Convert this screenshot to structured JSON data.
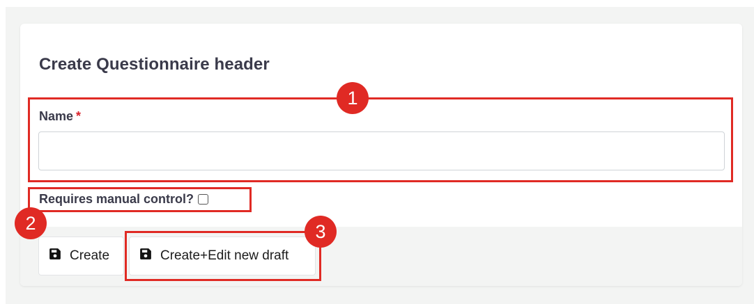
{
  "form": {
    "title": "Create Questionnaire header",
    "name_label": "Name",
    "required_mark": "*",
    "name_value": "",
    "name_placeholder": "",
    "manual_control_label": "Requires manual control?",
    "manual_control_checked": false
  },
  "actions": {
    "create_label": "Create",
    "create_draft_label": "Create+Edit new draft",
    "button_icon": "save-icon"
  },
  "annotations": [
    {
      "number": "1",
      "target": "name-field"
    },
    {
      "number": "2",
      "target": "manual-control-checkbox"
    },
    {
      "number": "3",
      "target": "create-edit-draft-button"
    }
  ],
  "colors": {
    "annotation_red": "#e02a24",
    "required_red": "#d9222a",
    "text_dark": "#3a3a4a",
    "page_bg": "#f3f4f3"
  }
}
